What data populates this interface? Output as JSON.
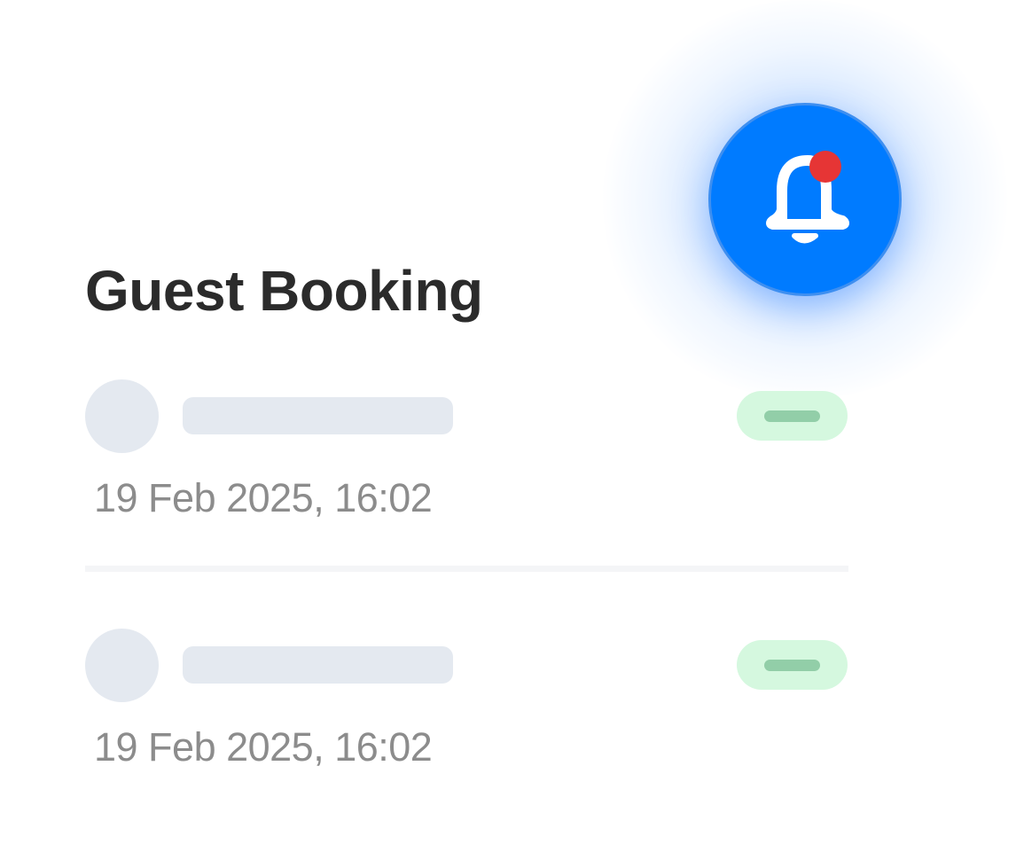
{
  "header": {
    "title": "Guest Booking"
  },
  "notification": {
    "icon": "bell-icon",
    "has_unread_dot": true,
    "button_color": "#007bff",
    "dot_color": "#e63535"
  },
  "bookings": [
    {
      "timestamp": "19 Feb 2025, 16:02"
    },
    {
      "timestamp": "19 Feb 2025, 16:02"
    }
  ],
  "colors": {
    "placeholder": "#e4e9f0",
    "status_pill_bg": "#d5f8df",
    "status_pill_bar": "#92cea8",
    "title": "#2b2b2b",
    "timestamp": "#8c8c8c"
  }
}
